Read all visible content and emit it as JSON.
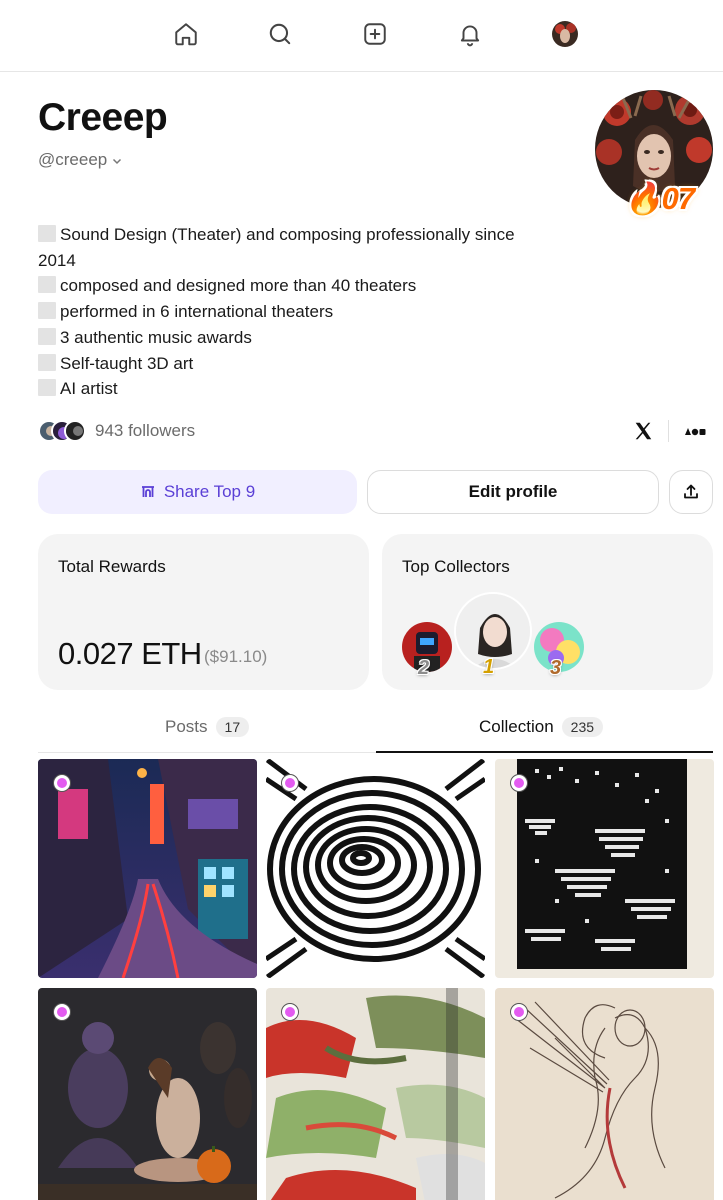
{
  "nav": {
    "items": [
      "home-icon",
      "search-icon",
      "create-icon",
      "notifications-icon",
      "profile-avatar"
    ]
  },
  "profile": {
    "display_name": "Creeep",
    "handle": "@creeep",
    "streak": "07",
    "bio": [
      "Sound Design (Theater) and composing professionally since",
      "2014",
      "composed and designed more than 40 theaters",
      "performed in 6 international theaters",
      "3 authentic music awards",
      "Self-taught 3D art",
      "AI artist"
    ],
    "followers_text": "943 followers"
  },
  "actions": {
    "share_label": "Share Top 9",
    "edit_label": "Edit profile"
  },
  "rewards": {
    "title": "Total Rewards",
    "value": "0.027 ETH",
    "usd": "($91.10)"
  },
  "collectors": {
    "title": "Top Collectors",
    "ranks": [
      "2",
      "1",
      "3"
    ]
  },
  "tabs": [
    {
      "label": "Posts",
      "count": "17"
    },
    {
      "label": "Collection",
      "count": "235"
    }
  ],
  "colors": {
    "accent": "#5a3fd6",
    "accent_bg": "#f1efff",
    "tile_dot": "#e35bf0",
    "streak": "#ff6a00"
  }
}
